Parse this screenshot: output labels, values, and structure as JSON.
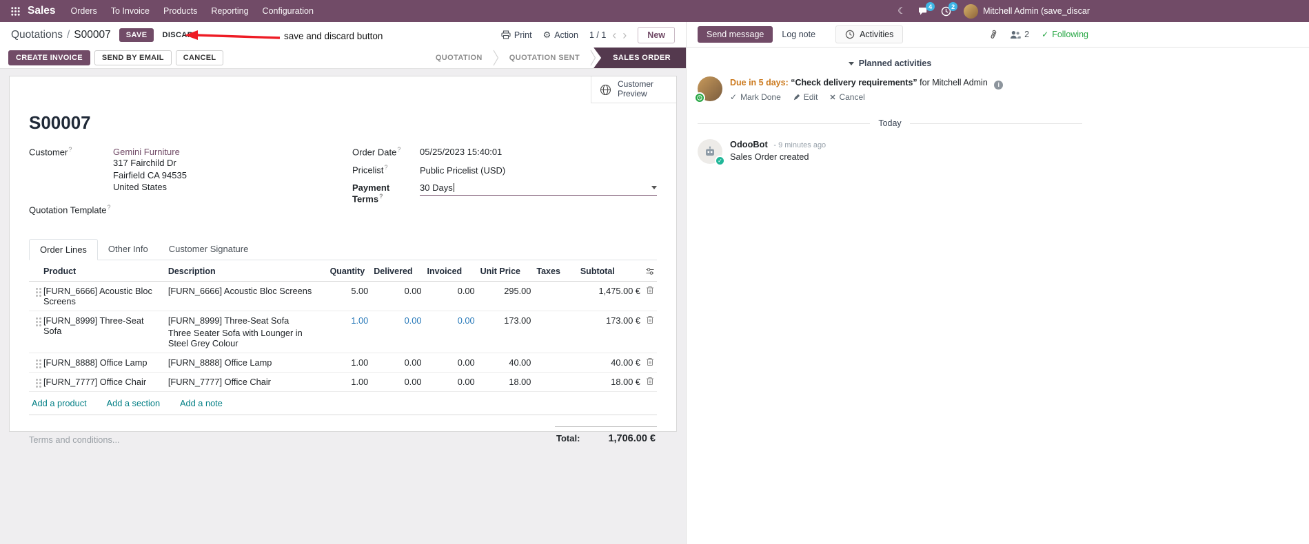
{
  "colors": {
    "accent": "#714B67",
    "accent-dark": "#54394e",
    "link-blue": "#2577b8",
    "link-teal": "#017e84",
    "due-orange": "#cc7a1e",
    "green": "#28a745",
    "red": "#e8241d"
  },
  "nav": {
    "app_name": "Sales",
    "menus": [
      "Orders",
      "To Invoice",
      "Products",
      "Reporting",
      "Configuration"
    ],
    "chat_badge": "4",
    "clock_badge": "2",
    "user_name": "Mitchell Admin (save_discar"
  },
  "control_panel": {
    "breadcrumb_parent": "Quotations",
    "breadcrumb_sep": "/",
    "breadcrumb_current": "S00007",
    "save": "SAVE",
    "discard": "DISCARD",
    "print": "Print",
    "action": "Action",
    "pager": "1 / 1",
    "prev": "‹",
    "next": "›",
    "new": "New"
  },
  "annotation": {
    "text": "save and discard button"
  },
  "statusbar": {
    "create_invoice": "CREATE INVOICE",
    "send_by_email": "SEND BY EMAIL",
    "cancel": "CANCEL",
    "steps": [
      {
        "label": "QUOTATION"
      },
      {
        "label": "QUOTATION SENT"
      },
      {
        "label": "SALES ORDER"
      }
    ]
  },
  "form": {
    "customer_preview": "Customer Preview",
    "title": "S00007",
    "hint": "?",
    "customer_label": "Customer",
    "customer_name": "Gemini Furniture",
    "customer_address": [
      "317 Fairchild Dr",
      "Fairfield CA 94535",
      "United States"
    ],
    "quotation_template_label": "Quotation Template",
    "order_date_label": "Order Date",
    "order_date_value": "05/25/2023 15:40:01",
    "pricelist_label": "Pricelist",
    "pricelist_value": "Public Pricelist (USD)",
    "payment_terms_label": "Payment Terms",
    "payment_terms_value": "30 Days",
    "tabs": [
      {
        "label": "Order Lines"
      },
      {
        "label": "Other Info"
      },
      {
        "label": "Customer Signature"
      }
    ],
    "table": {
      "headers": [
        "Product",
        "Description",
        "Quantity",
        "Delivered",
        "Invoiced",
        "Unit Price",
        "Taxes",
        "Subtotal"
      ],
      "rows": [
        {
          "product": "[FURN_6666] Acoustic Bloc Screens",
          "description": "[FURN_6666] Acoustic Bloc Screens",
          "description2": "",
          "quantity": "5.00",
          "delivered": "0.00",
          "invoiced": "0.00",
          "unit_price": "295.00",
          "taxes": "",
          "subtotal": "1,475.00 €"
        },
        {
          "product": "[FURN_8999] Three-Seat Sofa",
          "description": "[FURN_8999] Three-Seat Sofa",
          "description2": "Three Seater Sofa with Lounger in Steel Grey Colour",
          "quantity": "1.00",
          "delivered": "0.00",
          "invoiced": "0.00",
          "unit_price": "173.00",
          "taxes": "",
          "subtotal": "173.00 €"
        },
        {
          "product": "[FURN_8888] Office Lamp",
          "description": "[FURN_8888] Office Lamp",
          "description2": "",
          "quantity": "1.00",
          "delivered": "0.00",
          "invoiced": "0.00",
          "unit_price": "40.00",
          "taxes": "",
          "subtotal": "40.00 €"
        },
        {
          "product": "[FURN_7777] Office Chair",
          "description": "[FURN_7777] Office Chair",
          "description2": "",
          "quantity": "1.00",
          "delivered": "0.00",
          "invoiced": "0.00",
          "unit_price": "18.00",
          "taxes": "",
          "subtotal": "18.00 €"
        }
      ],
      "add_product": "Add a product",
      "add_section": "Add a section",
      "add_note": "Add a note"
    },
    "terms_placeholder": "Terms and conditions...",
    "total_label": "Total:",
    "total_value": "1,706.00 €"
  },
  "chatter": {
    "send_message": "Send message",
    "log_note": "Log note",
    "activities": "Activities",
    "followers_count": "2",
    "following": "Following",
    "planned_header": "Planned activities",
    "activity": {
      "due": "Due in 5 days:",
      "summary": "“Check delivery requirements”",
      "assignee": "for Mitchell Admin",
      "mark_done": "Mark Done",
      "edit": "Edit",
      "cancel": "Cancel"
    },
    "today": "Today",
    "message": {
      "author": "OdooBot",
      "time": "- 9 minutes ago",
      "body": "Sales Order created"
    }
  }
}
